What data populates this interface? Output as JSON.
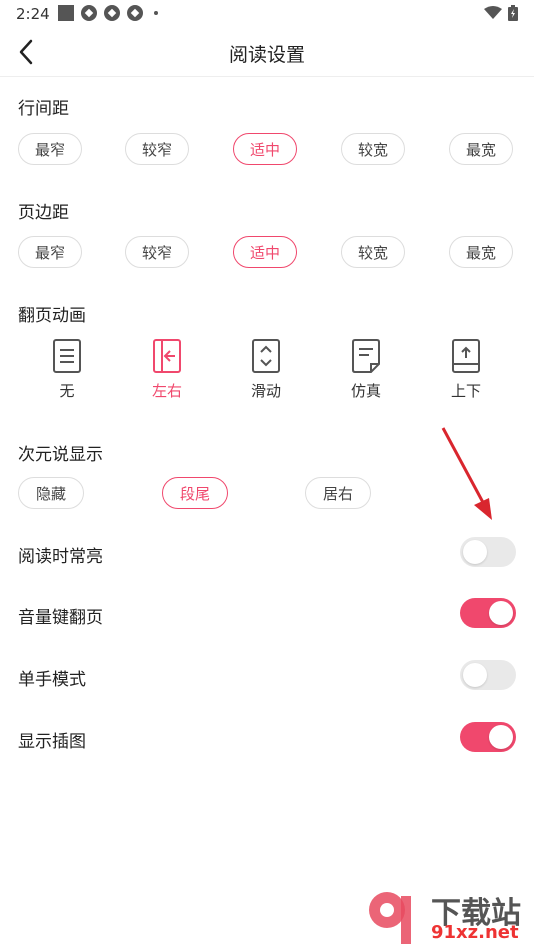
{
  "status": {
    "time": "2:24"
  },
  "header": {
    "title": "阅读设置"
  },
  "line_spacing": {
    "title": "行间距",
    "options": [
      "最窄",
      "较窄",
      "适中",
      "较宽",
      "最宽"
    ],
    "selected": "适中"
  },
  "page_margin": {
    "title": "页边距",
    "options": [
      "最窄",
      "较窄",
      "适中",
      "较宽",
      "最宽"
    ],
    "selected": "适中"
  },
  "page_animation": {
    "title": "翻页动画",
    "options": [
      {
        "label": "无",
        "icon": "page-none-icon"
      },
      {
        "label": "左右",
        "icon": "page-left-right-icon"
      },
      {
        "label": "滑动",
        "icon": "page-slide-icon"
      },
      {
        "label": "仿真",
        "icon": "page-curl-icon"
      },
      {
        "label": "上下",
        "icon": "page-up-down-icon"
      }
    ],
    "selected": "左右"
  },
  "subtitle_display": {
    "title": "次元说显示",
    "options": [
      "隐藏",
      "段尾",
      "居右"
    ],
    "selected": "段尾"
  },
  "toggles": [
    {
      "label": "阅读时常亮",
      "on": false
    },
    {
      "label": "音量键翻页",
      "on": true
    },
    {
      "label": "单手模式",
      "on": false
    },
    {
      "label": "显示插图",
      "on": true
    }
  ],
  "colors": {
    "accent": "#f0486d",
    "border": "#dddddd",
    "switch_off": "#e9e9e9"
  },
  "watermark": {
    "text": "下载站",
    "url": "91xz.net"
  }
}
